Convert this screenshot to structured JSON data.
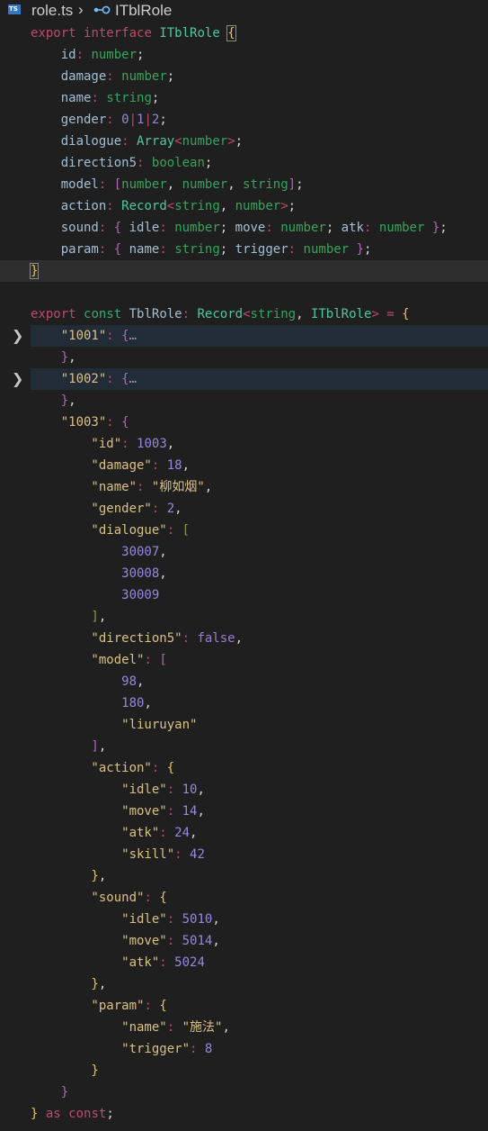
{
  "breadcrumb": {
    "file_icon": "TS",
    "file": "role.ts",
    "separator": "›",
    "symbol_icon": "interface-icon",
    "symbol": "ITblRole"
  },
  "colors": {
    "background": "#1f1f1f",
    "keyword": "#c04a6a",
    "type": "#4ec9a0",
    "number": "#9a86e0",
    "string": "#dcc084"
  },
  "folded_lines": [
    14,
    16
  ],
  "current_line": 11,
  "lines": [
    [
      [
        "export",
        "kw"
      ],
      [
        " ",
        "p"
      ],
      [
        "interface",
        "kw"
      ],
      [
        " ",
        "p"
      ],
      [
        "ITblRole",
        "tp"
      ],
      [
        " ",
        "p"
      ],
      [
        "{",
        "b1 bx"
      ]
    ],
    [
      [
        "    id",
        "pr"
      ],
      [
        ":",
        "op"
      ],
      [
        " ",
        "p"
      ],
      [
        "number",
        "nm"
      ],
      [
        ";",
        "p"
      ]
    ],
    [
      [
        "    damage",
        "pr"
      ],
      [
        ":",
        "op"
      ],
      [
        " ",
        "p"
      ],
      [
        "number",
        "nm"
      ],
      [
        ";",
        "p"
      ]
    ],
    [
      [
        "    name",
        "pr"
      ],
      [
        ":",
        "op"
      ],
      [
        " ",
        "p"
      ],
      [
        "string",
        "nm"
      ],
      [
        ";",
        "p"
      ]
    ],
    [
      [
        "    gender",
        "pr"
      ],
      [
        ":",
        "op"
      ],
      [
        " ",
        "p"
      ],
      [
        "0",
        "num"
      ],
      [
        "|",
        "op"
      ],
      [
        "1",
        "num"
      ],
      [
        "|",
        "op"
      ],
      [
        "2",
        "num"
      ],
      [
        ";",
        "p"
      ]
    ],
    [
      [
        "    dialogue",
        "pr"
      ],
      [
        ":",
        "op"
      ],
      [
        " ",
        "p"
      ],
      [
        "Array",
        "tp"
      ],
      [
        "<",
        "op"
      ],
      [
        "number",
        "nm"
      ],
      [
        ">",
        "op"
      ],
      [
        ";",
        "p"
      ]
    ],
    [
      [
        "    direction5",
        "pr"
      ],
      [
        ":",
        "op"
      ],
      [
        " ",
        "p"
      ],
      [
        "boolean",
        "nm"
      ],
      [
        ";",
        "p"
      ]
    ],
    [
      [
        "    model",
        "pr"
      ],
      [
        ":",
        "op"
      ],
      [
        " ",
        "p"
      ],
      [
        "[",
        "b2"
      ],
      [
        "number",
        "nm"
      ],
      [
        ", ",
        "p"
      ],
      [
        "number",
        "nm"
      ],
      [
        ", ",
        "p"
      ],
      [
        "string",
        "nm"
      ],
      [
        "]",
        "b2"
      ],
      [
        ";",
        "p"
      ]
    ],
    [
      [
        "    action",
        "pr"
      ],
      [
        ":",
        "op"
      ],
      [
        " ",
        "p"
      ],
      [
        "Record",
        "tp"
      ],
      [
        "<",
        "op"
      ],
      [
        "string",
        "nm"
      ],
      [
        ", ",
        "p"
      ],
      [
        "number",
        "nm"
      ],
      [
        ">",
        "op"
      ],
      [
        ";",
        "p"
      ]
    ],
    [
      [
        "    sound",
        "pr"
      ],
      [
        ":",
        "op"
      ],
      [
        " ",
        "p"
      ],
      [
        "{",
        "b2"
      ],
      [
        " idle",
        "pr"
      ],
      [
        ":",
        "op"
      ],
      [
        " ",
        "p"
      ],
      [
        "number",
        "nm"
      ],
      [
        "; ",
        "p"
      ],
      [
        "move",
        "pr"
      ],
      [
        ":",
        "op"
      ],
      [
        " ",
        "p"
      ],
      [
        "number",
        "nm"
      ],
      [
        "; ",
        "p"
      ],
      [
        "atk",
        "pr"
      ],
      [
        ":",
        "op"
      ],
      [
        " ",
        "p"
      ],
      [
        "number",
        "nm"
      ],
      [
        " ",
        "p"
      ],
      [
        "}",
        "b2"
      ],
      [
        ";",
        "p"
      ]
    ],
    [
      [
        "    param",
        "pr"
      ],
      [
        ":",
        "op"
      ],
      [
        " ",
        "p"
      ],
      [
        "{",
        "b2"
      ],
      [
        " name",
        "pr"
      ],
      [
        ":",
        "op"
      ],
      [
        " ",
        "p"
      ],
      [
        "string",
        "nm"
      ],
      [
        "; ",
        "p"
      ],
      [
        "trigger",
        "pr"
      ],
      [
        ":",
        "op"
      ],
      [
        " ",
        "p"
      ],
      [
        "number",
        "nm"
      ],
      [
        " ",
        "p"
      ],
      [
        "}",
        "b2"
      ],
      [
        ";",
        "p"
      ]
    ],
    [
      [
        "}",
        "b1 bx"
      ]
    ],
    [],
    [
      [
        "export",
        "kw"
      ],
      [
        " ",
        "p"
      ],
      [
        "const",
        "kc"
      ],
      [
        " ",
        "p"
      ],
      [
        "TblRole",
        "pr"
      ],
      [
        ":",
        "op"
      ],
      [
        " ",
        "p"
      ],
      [
        "Record",
        "tp"
      ],
      [
        "<",
        "op"
      ],
      [
        "string",
        "nm"
      ],
      [
        ", ",
        "p"
      ],
      [
        "ITblRole",
        "tp"
      ],
      [
        ">",
        "op"
      ],
      [
        " ",
        "p"
      ],
      [
        "=",
        "op"
      ],
      [
        " ",
        "p"
      ],
      [
        "{",
        "b1"
      ]
    ],
    [
      [
        "    \"1001\"",
        "str"
      ],
      [
        ":",
        "op"
      ],
      [
        " ",
        "p"
      ],
      [
        "{",
        "b2"
      ],
      [
        "…",
        "ell"
      ]
    ],
    [
      [
        "    }",
        "b2"
      ],
      [
        ",",
        "p"
      ]
    ],
    [
      [
        "    \"1002\"",
        "str"
      ],
      [
        ":",
        "op"
      ],
      [
        " ",
        "p"
      ],
      [
        "{",
        "b2"
      ],
      [
        "…",
        "ell"
      ]
    ],
    [
      [
        "    }",
        "b2"
      ],
      [
        ",",
        "p"
      ]
    ],
    [
      [
        "    \"1003\"",
        "str"
      ],
      [
        ":",
        "op"
      ],
      [
        " ",
        "p"
      ],
      [
        "{",
        "b2"
      ]
    ],
    [
      [
        "        \"id\"",
        "str"
      ],
      [
        ":",
        "op"
      ],
      [
        " ",
        "p"
      ],
      [
        "1003",
        "num"
      ],
      [
        ",",
        "p"
      ]
    ],
    [
      [
        "        \"damage\"",
        "str"
      ],
      [
        ":",
        "op"
      ],
      [
        " ",
        "p"
      ],
      [
        "18",
        "num"
      ],
      [
        ",",
        "p"
      ]
    ],
    [
      [
        "        \"name\"",
        "str"
      ],
      [
        ":",
        "op"
      ],
      [
        " ",
        "p"
      ],
      [
        "\"柳如烟\"",
        "str"
      ],
      [
        ",",
        "p"
      ]
    ],
    [
      [
        "        \"gender\"",
        "str"
      ],
      [
        ":",
        "op"
      ],
      [
        " ",
        "p"
      ],
      [
        "2",
        "num"
      ],
      [
        ",",
        "p"
      ]
    ],
    [
      [
        "        \"dialogue\"",
        "str"
      ],
      [
        ":",
        "op"
      ],
      [
        " ",
        "p"
      ],
      [
        "[",
        "b4"
      ]
    ],
    [
      [
        "            30007",
        "num"
      ],
      [
        ",",
        "p"
      ]
    ],
    [
      [
        "            30008",
        "num"
      ],
      [
        ",",
        "p"
      ]
    ],
    [
      [
        "            30009",
        "num"
      ]
    ],
    [
      [
        "        ]",
        "b4"
      ],
      [
        ",",
        "p"
      ]
    ],
    [
      [
        "        \"direction5\"",
        "str"
      ],
      [
        ":",
        "op"
      ],
      [
        " ",
        "p"
      ],
      [
        "false",
        "boo"
      ],
      [
        ",",
        "p"
      ]
    ],
    [
      [
        "        \"model\"",
        "str"
      ],
      [
        ":",
        "op"
      ],
      [
        " ",
        "p"
      ],
      [
        "[",
        "b2"
      ]
    ],
    [
      [
        "            98",
        "num"
      ],
      [
        ",",
        "p"
      ]
    ],
    [
      [
        "            180",
        "num"
      ],
      [
        ",",
        "p"
      ]
    ],
    [
      [
        "            \"liuruyan\"",
        "str"
      ]
    ],
    [
      [
        "        ]",
        "b2"
      ],
      [
        ",",
        "p"
      ]
    ],
    [
      [
        "        \"action\"",
        "str"
      ],
      [
        ":",
        "op"
      ],
      [
        " ",
        "p"
      ],
      [
        "{",
        "b1"
      ]
    ],
    [
      [
        "            \"idle\"",
        "str"
      ],
      [
        ":",
        "op"
      ],
      [
        " ",
        "p"
      ],
      [
        "10",
        "num"
      ],
      [
        ",",
        "p"
      ]
    ],
    [
      [
        "            \"move\"",
        "str"
      ],
      [
        ":",
        "op"
      ],
      [
        " ",
        "p"
      ],
      [
        "14",
        "num"
      ],
      [
        ",",
        "p"
      ]
    ],
    [
      [
        "            \"atk\"",
        "str"
      ],
      [
        ":",
        "op"
      ],
      [
        " ",
        "p"
      ],
      [
        "24",
        "num"
      ],
      [
        ",",
        "p"
      ]
    ],
    [
      [
        "            \"skill\"",
        "str"
      ],
      [
        ":",
        "op"
      ],
      [
        " ",
        "p"
      ],
      [
        "42",
        "num"
      ]
    ],
    [
      [
        "        }",
        "b1"
      ],
      [
        ",",
        "p"
      ]
    ],
    [
      [
        "        \"sound\"",
        "str"
      ],
      [
        ":",
        "op"
      ],
      [
        " ",
        "p"
      ],
      [
        "{",
        "b1"
      ]
    ],
    [
      [
        "            \"idle\"",
        "str"
      ],
      [
        ":",
        "op"
      ],
      [
        " ",
        "p"
      ],
      [
        "5010",
        "num"
      ],
      [
        ",",
        "p"
      ]
    ],
    [
      [
        "            \"move\"",
        "str"
      ],
      [
        ":",
        "op"
      ],
      [
        " ",
        "p"
      ],
      [
        "5014",
        "num"
      ],
      [
        ",",
        "p"
      ]
    ],
    [
      [
        "            \"atk\"",
        "str"
      ],
      [
        ":",
        "op"
      ],
      [
        " ",
        "p"
      ],
      [
        "5024",
        "num"
      ]
    ],
    [
      [
        "        }",
        "b1"
      ],
      [
        ",",
        "p"
      ]
    ],
    [
      [
        "        \"param\"",
        "str"
      ],
      [
        ":",
        "op"
      ],
      [
        " ",
        "p"
      ],
      [
        "{",
        "b1"
      ]
    ],
    [
      [
        "            \"name\"",
        "str"
      ],
      [
        ":",
        "op"
      ],
      [
        " ",
        "p"
      ],
      [
        "\"施法\"",
        "str"
      ],
      [
        ",",
        "p"
      ]
    ],
    [
      [
        "            \"trigger\"",
        "str"
      ],
      [
        ":",
        "op"
      ],
      [
        " ",
        "p"
      ],
      [
        "8",
        "num"
      ]
    ],
    [
      [
        "        }",
        "b1"
      ]
    ],
    [
      [
        "    }",
        "b2"
      ]
    ],
    [
      [
        "}",
        "b1"
      ],
      [
        " ",
        "p"
      ],
      [
        "as",
        "kw"
      ],
      [
        " ",
        "p"
      ],
      [
        "const",
        "kw"
      ],
      [
        ";",
        "p"
      ]
    ]
  ]
}
